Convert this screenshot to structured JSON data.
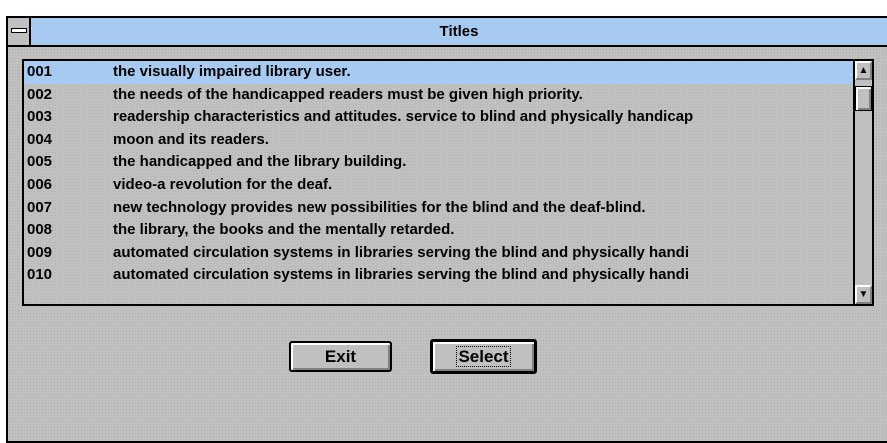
{
  "window": {
    "title": "Titles"
  },
  "list": {
    "selected_index": 0,
    "rows": [
      {
        "id": "001",
        "title": "the visually impaired library user."
      },
      {
        "id": "002",
        "title": "the needs of the handicapped readers must be given high priority."
      },
      {
        "id": "003",
        "title": "readership characteristics and attitudes. service to blind and physically  handicap"
      },
      {
        "id": "004",
        "title": "moon and its readers."
      },
      {
        "id": "005",
        "title": "the handicapped and the library building."
      },
      {
        "id": "006",
        "title": "video-a revolution for the deaf."
      },
      {
        "id": "007",
        "title": "new technology provides new possibilities for the blind and the deaf-blind."
      },
      {
        "id": "008",
        "title": "the library, the books and the mentally retarded."
      },
      {
        "id": "009",
        "title": "automated circulation systems in libraries serving the blind and physically  handi"
      },
      {
        "id": "010",
        "title": "automated circulation systems in libraries serving the blind and physically  handi"
      }
    ]
  },
  "scrollbar": {
    "up_icon": "up-arrow-icon",
    "down_icon": "down-arrow-icon"
  },
  "buttons": {
    "exit_label": "Exit",
    "select_label": "Select"
  },
  "colors": {
    "title_bar": "#a6caf0",
    "selection": "#a6caf0",
    "face": "#c0c0c0"
  }
}
